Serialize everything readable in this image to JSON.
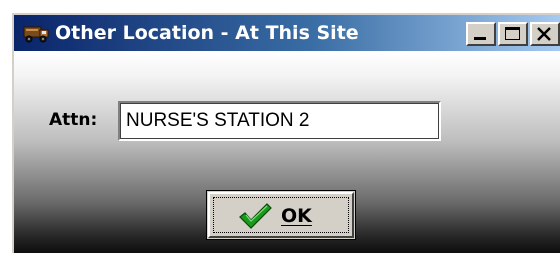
{
  "window": {
    "title": "Other Location - At This Site",
    "icon": "truck-icon",
    "controls": {
      "minimize_icon": "minimize-icon",
      "maximize_icon": "maximize-icon",
      "close_icon": "close-icon"
    }
  },
  "form": {
    "attn_label": "Attn:",
    "attn_value": "NURSE'S STATION 2"
  },
  "ok_button": {
    "label": "OK",
    "icon": "checkmark-icon",
    "check_color": "#1a9a1a"
  },
  "colors": {
    "titlebar_start": "#0a246a",
    "titlebar_end": "#a6caf0",
    "face": "#d4d0c8"
  }
}
